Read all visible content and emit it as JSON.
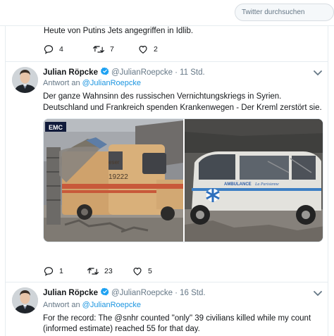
{
  "search": {
    "placeholder": "Twitter durchsuchen"
  },
  "tweet0": {
    "text": "Heute von Putins Jets angegriffen in Idlib.",
    "replies": "4",
    "retweets": "7",
    "likes": "2"
  },
  "tweet1": {
    "name": "Julian Röpcke",
    "handle": "@JulianRoepcke",
    "time": "· 11 Std.",
    "reply_prefix": "Antwort an",
    "reply_to": "@JulianRoepcke",
    "lines": [
      "Der ganze Wahnsinn des russischen Vernichtungskriegs in Syrien.",
      "Deutschland und Frankreich spenden Krankenwegen - Der Kreml zerstört sie."
    ],
    "media": {
      "left_badge": "EMC",
      "left_vehicle_number": "19222",
      "left_vehicle_text": "eser",
      "right_vehicle_text": "AMBULANCE",
      "right_vehicle_script": "La Parisienne"
    },
    "replies": "1",
    "retweets": "23",
    "likes": "5"
  },
  "tweet2": {
    "name": "Julian Röpcke",
    "handle": "@JulianRoepcke",
    "time": "· 16 Std.",
    "reply_prefix": "Antwort an",
    "reply_to": "@JulianRoepcke",
    "lines": [
      "For the record: The @snhr counted \"only\" 39 civilians killed while my count",
      "(informed estimate) reached 55 for that day."
    ]
  },
  "colors": {
    "accent": "#1da1f2",
    "link": "#1b95e0",
    "muted": "#657786",
    "text": "#14171a",
    "divider": "#e6ecf0"
  },
  "icons": [
    "reply-icon",
    "retweet-icon",
    "like-icon",
    "verified-badge-icon",
    "chevron-down-icon"
  ]
}
